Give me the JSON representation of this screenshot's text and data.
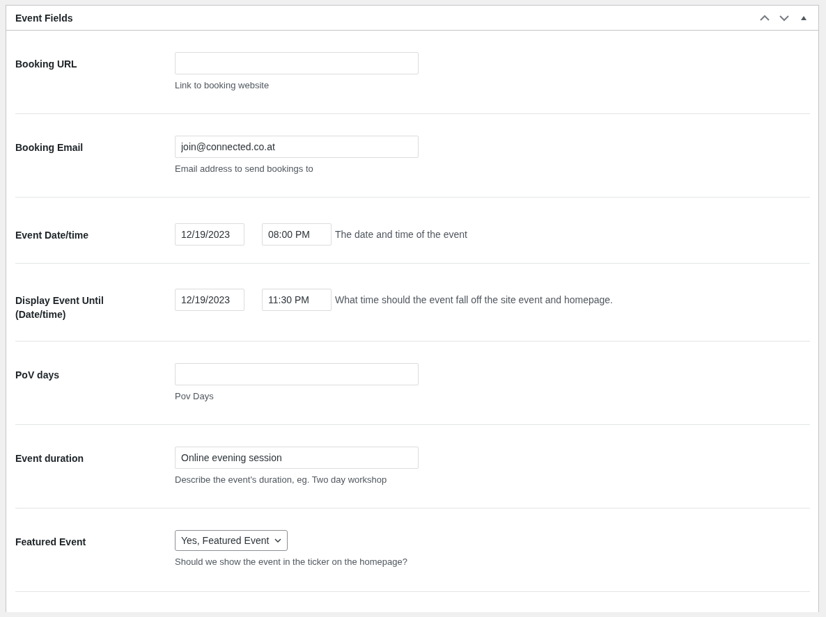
{
  "panel": {
    "title": "Event Fields"
  },
  "fields": [
    {
      "kind": "text",
      "label": "Booking URL",
      "description": "Link to booking website"
    },
    {
      "kind": "text",
      "label": "Booking Email",
      "value": "join@connected.co.at",
      "description": "Email address to send bookings to"
    },
    {
      "kind": "datetime",
      "label": "Event Date/time",
      "date": "12/19/2023",
      "time": "08:00 PM",
      "description": "The date and time of the event"
    },
    {
      "kind": "datetime",
      "label": "Display Event Until (Date/time)",
      "date": "12/19/2023",
      "time": "11:30 PM",
      "description": "What time should the event fall off the site event and homepage."
    },
    {
      "kind": "text",
      "label": "PoV days",
      "description": "Pov Days"
    },
    {
      "kind": "text",
      "label": "Event duration",
      "value": "Online evening session",
      "description": "Describe the event's duration, eg. Two day workshop"
    },
    {
      "kind": "select",
      "label": "Featured Event",
      "value": "Yes, Featured Event",
      "description": "Should we show the event in the ticker on the homepage?"
    }
  ]
}
